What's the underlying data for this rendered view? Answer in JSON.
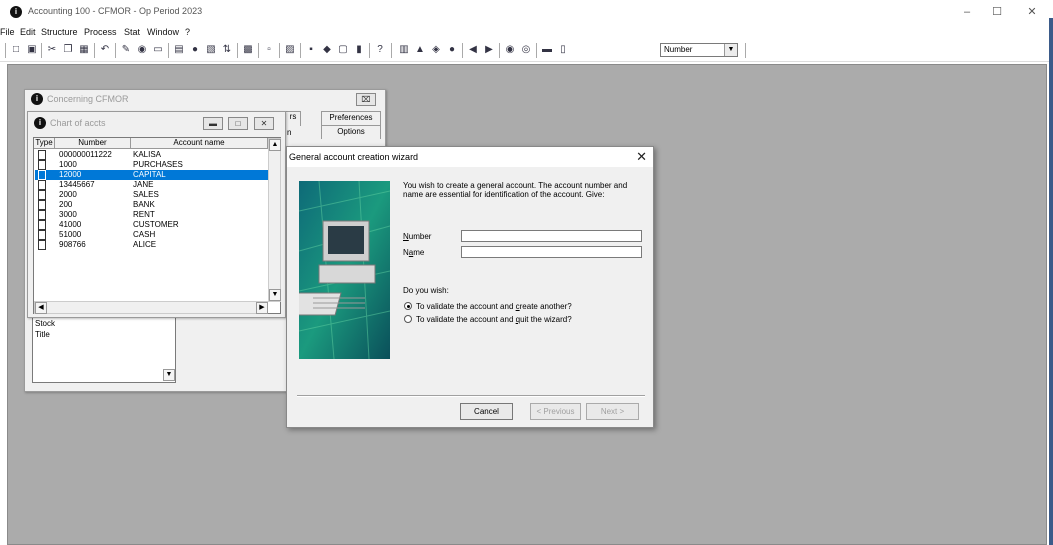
{
  "app": {
    "title": "Accounting 100 - CFMOR - Op Period 2023",
    "logo_glyph": "i"
  },
  "window_controls": {
    "minimize": "–",
    "maximize": "☐",
    "close": "✕"
  },
  "menu": [
    "File",
    "Edit",
    "Structure",
    "Process",
    "Stat",
    "Window",
    "?"
  ],
  "toolbar": {
    "combo_value": "Number",
    "combo_arrow": "▼"
  },
  "concerning_window": {
    "title": "Concerning CFMOR",
    "close": "⌧",
    "tabs": [
      "rs",
      "Preferences",
      "Options",
      "n"
    ],
    "list_items": [
      "Stock",
      "Title"
    ]
  },
  "chart_window": {
    "title": "Chart of accts",
    "columns": [
      "Type",
      "Number",
      "Account name"
    ],
    "rows": [
      {
        "number": "000000011222",
        "name": "KALISA",
        "selected": false
      },
      {
        "number": "1000",
        "name": "PURCHASES",
        "selected": false
      },
      {
        "number": "12000",
        "name": "CAPITAL",
        "selected": true
      },
      {
        "number": "13445667",
        "name": "JANE",
        "selected": false
      },
      {
        "number": "2000",
        "name": "SALES",
        "selected": false
      },
      {
        "number": "200",
        "name": "BANK",
        "selected": false
      },
      {
        "number": "3000",
        "name": "RENT",
        "selected": false
      },
      {
        "number": "41000",
        "name": "CUSTOMER",
        "selected": false
      },
      {
        "number": "51000",
        "name": "CASH",
        "selected": false
      },
      {
        "number": "908766",
        "name": "ALICE",
        "selected": false
      }
    ]
  },
  "wizard": {
    "title": "General account creation wizard",
    "intro": "You wish to create a general account. The account number and name are essential for identification of the account. Give:",
    "number_label_u": "N",
    "number_label_rest": "umber",
    "number_value": "",
    "name_label_a": "N",
    "name_label_u": "a",
    "name_label_rest": "me",
    "name_value": "",
    "question": "Do you wish:",
    "option1_a": "To validate the account and ",
    "option1_u": "c",
    "option1_b": "reate another?",
    "option1_checked": true,
    "option2_a": "To validate the account and ",
    "option2_u": "q",
    "option2_b": "uit the wizard?",
    "option2_checked": false,
    "cancel": "Cancel",
    "previous": "< Previous",
    "next": "Next >",
    "close": "✕"
  }
}
